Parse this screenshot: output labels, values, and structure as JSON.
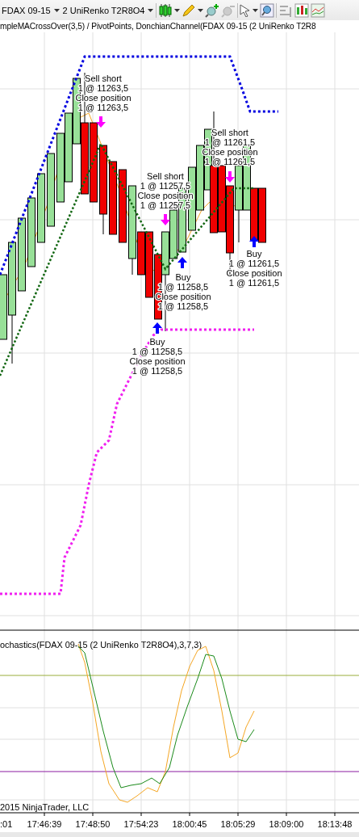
{
  "toolbar": {
    "instrument": "FDAX 09-15",
    "period": "2 UniRenko T2R8O4"
  },
  "chart": {
    "title": "mpleMACrossOver(3,5) / PivotPoints, DonchianChannel(FDAX 09-15 (2 UniRenko T2R8",
    "signals": [
      {
        "kind": "sell",
        "action": "Sell short",
        "entry": "1 @ 11263,5",
        "close": "Close position",
        "exit": "1 @ 11263,5"
      },
      {
        "kind": "sell",
        "action": "Sell short",
        "entry": "1 @ 11261,5",
        "close": "Close position",
        "exit": "1 @ 11261,5"
      },
      {
        "kind": "sell",
        "action": "Sell short",
        "entry": "1 @ 11257,5",
        "close": "Close position",
        "exit": "1 @ 11257,5"
      },
      {
        "kind": "buy",
        "action": "Buy",
        "entry": "1 @ 11258,5",
        "close": "Close position",
        "exit": "1 @ 11258,5"
      },
      {
        "kind": "buy",
        "action": "Buy",
        "entry": "1 @ 11261,5",
        "close": "Close position",
        "exit": "1 @ 11261,5"
      },
      {
        "kind": "buy",
        "action": "Buy",
        "entry": "1 @ 11258,5",
        "close": "Close position",
        "exit": "1 @ 11258,5"
      }
    ]
  },
  "indicator_panel": {
    "title": "ochastics(FDAX 09-15 (2 UniRenko T2R8O4),3,7,3)",
    "copyright": "2015 NinjaTrader, LLC"
  },
  "x_axis": {
    "labels": [
      ":01",
      "17:46:39",
      "17:48:50",
      "17:54:23",
      "18:00:45",
      "18:05:29",
      "18:09:00",
      "18:13:48"
    ]
  }
}
